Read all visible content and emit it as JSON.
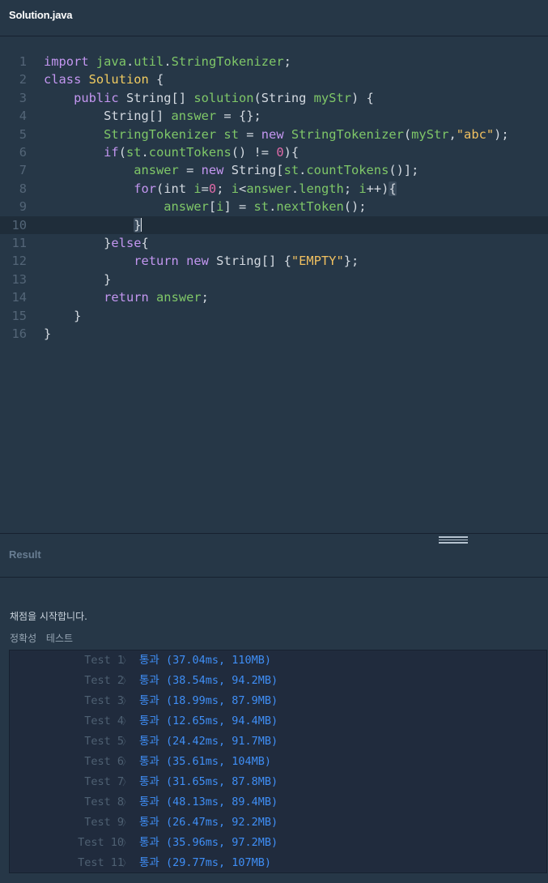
{
  "header": {
    "file_name": "Solution.java"
  },
  "editor": {
    "line_numbers": [
      "1",
      "2",
      "3",
      "4",
      "5",
      "6",
      "7",
      "8",
      "9",
      "10",
      "11",
      "12",
      "13",
      "14",
      "15",
      "16"
    ],
    "active_line": 10
  },
  "result_panel": {
    "title": "Result",
    "status_text": "채점을 시작합니다.",
    "section_label": "정확성  테스트",
    "tests": [
      {
        "name": "Test 1",
        "verdict": "통과",
        "detail": "(37.04ms, 110MB)"
      },
      {
        "name": "Test 2",
        "verdict": "통과",
        "detail": "(38.54ms, 94.2MB)"
      },
      {
        "name": "Test 3",
        "verdict": "통과",
        "detail": "(18.99ms, 87.9MB)"
      },
      {
        "name": "Test 4",
        "verdict": "통과",
        "detail": "(12.65ms, 94.4MB)"
      },
      {
        "name": "Test 5",
        "verdict": "통과",
        "detail": "(24.42ms, 91.7MB)"
      },
      {
        "name": "Test 6",
        "verdict": "통과",
        "detail": "(35.61ms, 104MB)"
      },
      {
        "name": "Test 7",
        "verdict": "통과",
        "detail": "(31.65ms, 87.8MB)"
      },
      {
        "name": "Test 8",
        "verdict": "통과",
        "detail": "(48.13ms, 89.4MB)"
      },
      {
        "name": "Test 9",
        "verdict": "통과",
        "detail": "(26.47ms, 92.2MB)"
      },
      {
        "name": "Test 10",
        "verdict": "통과",
        "detail": "(35.96ms, 97.2MB)"
      },
      {
        "name": "Test 11",
        "verdict": "통과",
        "detail": "(29.77ms, 107MB)"
      }
    ]
  },
  "colors": {
    "background": "#263747",
    "keyword": "#c396f0",
    "identifier": "#7fc768",
    "class_name": "#f2cc60",
    "number": "#e06aa8",
    "pass": "#3f8ef5"
  }
}
